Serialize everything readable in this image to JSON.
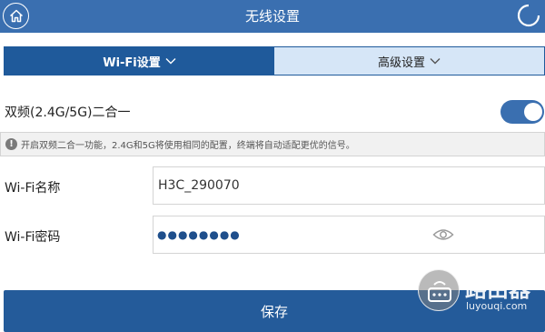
{
  "header": {
    "title": "无线设置"
  },
  "tabs": [
    {
      "label": "Wi-Fi设置"
    },
    {
      "label": "高级设置"
    }
  ],
  "dual_band": {
    "label": "双频(2.4G/5G)二合一",
    "enabled": true
  },
  "notice": {
    "text": "开启双频二合一功能，2.4G和5G将使用相同的配置，终端将自动适配更优的信号。"
  },
  "wifi_name": {
    "label": "Wi-Fi名称",
    "value": "H3C_290070"
  },
  "wifi_password": {
    "label": "Wi-Fi密码",
    "value": "●●●●●●●●"
  },
  "save_button": {
    "label": "保存"
  },
  "watermark": {
    "title": "路由器",
    "url": "luyouqi.com"
  },
  "colors": {
    "primary": "#3a6fb0",
    "accent_dark": "#1f5a9b",
    "tab_inactive": "#d6e6f7"
  },
  "icons": {
    "home": "home-icon",
    "refresh": "refresh-icon",
    "info": "info-icon",
    "eye": "eye-icon",
    "chevron": "chevron-down-icon"
  }
}
